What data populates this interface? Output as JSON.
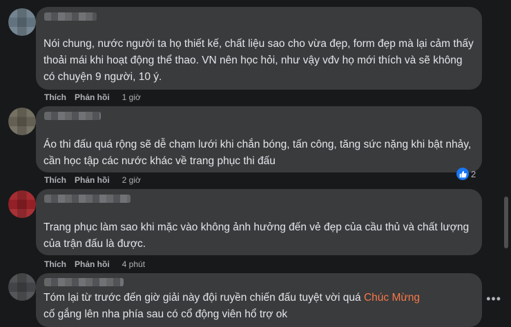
{
  "comments": [
    {
      "text": "Nói chung, nước người ta họ thiết kế, chất liệu sao cho vừa đẹp, form đẹp mà lại cảm thấy thoải mái khi hoạt động thể thao. VN nên học hỏi, như vậy vđv họ mới thích và sẽ không có chuyện 9 người, 10 ý.",
      "like_label": "Thích",
      "reply_label": "Phản hồi",
      "time": "1 giờ"
    },
    {
      "text": "Áo thi đấu quá rộng sẽ dễ chạm lưới khi chắn bóng, tấn công, tăng sức nặng khi bật nhảy, cần học tập các nước khác về trang phục thi đấu",
      "like_label": "Thích",
      "reply_label": "Phản hồi",
      "time": "2 giờ",
      "reaction_count": "2"
    },
    {
      "text": "Trang phục làm sao khi mặc vào không ảnh hưởng đến vẻ đẹp của cầu thủ và chất lượng của trận đấu là được.",
      "like_label": "Thích",
      "reply_label": "Phản hồi",
      "time": "4 phút"
    },
    {
      "text_before": "Tóm lại từ trước đến giờ giải này đội ruyền chiến đấu tuyệt vời quá ",
      "text_highlight": "Chúc Mừng",
      "text_after": "cố gắng lên nha phía sau có cổ động viên hổ trợ ok"
    }
  ],
  "colors": {
    "background": "#18191a",
    "bubble": "#3a3b3c",
    "text": "#e4e6eb",
    "secondary_text": "#b0b3b8",
    "like_blue": "#1877f2",
    "highlight": "#f7784a"
  },
  "icons": {
    "reaction": "thumbs-up-icon",
    "more": "more-options-icon"
  }
}
